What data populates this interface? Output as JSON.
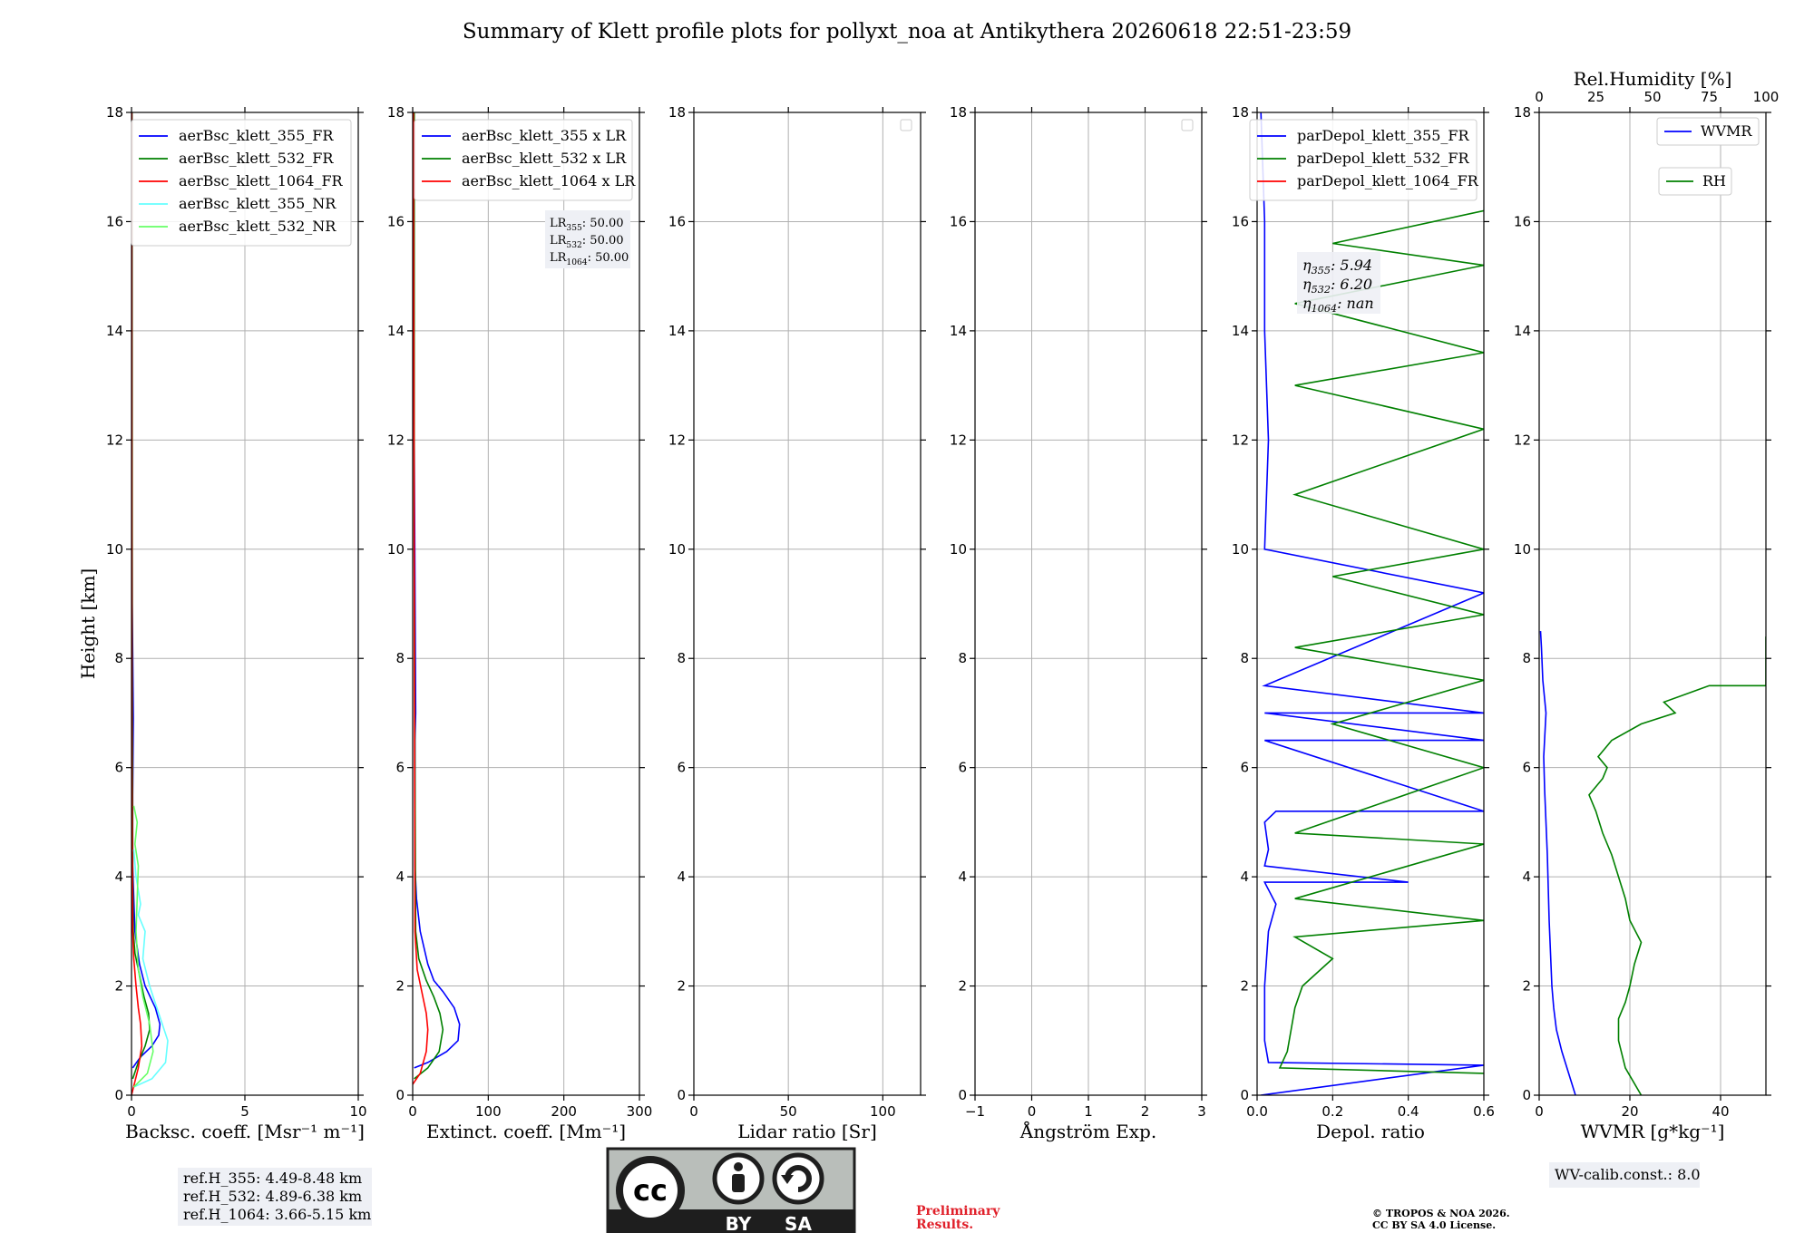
{
  "title": "Summary of Klett profile plots for pollyxt_noa at Antikythera 20260618 22:51-23:59",
  "ylabel": "Height [km]",
  "colors": {
    "blue": "#0000ff",
    "green": "#008000",
    "red": "#ff0000",
    "cyan": "#66ffff",
    "lightgreen": "#66ff66",
    "grid": "#b0b0b0"
  },
  "chart_data": [
    {
      "type": "line",
      "xlabel": "Backsc. coeff. [Msr⁻¹ m⁻¹]",
      "ylabel": "Height [km]",
      "xlim": [
        0,
        10
      ],
      "ylim": [
        0,
        18
      ],
      "xticks": [
        "0",
        "5",
        "10"
      ],
      "yticks": [
        "0",
        "2",
        "4",
        "6",
        "8",
        "10",
        "12",
        "14",
        "16",
        "18"
      ],
      "grid": true,
      "legend_placement": "top-right",
      "series": [
        {
          "name": "aerBsc_klett_355_FR",
          "color": "#0000ff",
          "x": [
            0.05,
            0.4,
            0.9,
            1.2,
            1.25,
            1.05,
            0.6,
            0.35,
            0.15,
            0.1,
            0.05,
            0.05,
            0.08,
            0.03,
            0.02,
            0.01
          ],
          "y": [
            0.5,
            0.7,
            0.9,
            1.1,
            1.3,
            1.6,
            2.0,
            2.4,
            3.0,
            3.6,
            4.2,
            5.5,
            6.9,
            9.0,
            13.0,
            18.0
          ]
        },
        {
          "name": "aerBsc_klett_532_FR",
          "color": "#008000",
          "x": [
            0.05,
            0.3,
            0.6,
            0.8,
            0.75,
            0.55,
            0.35,
            0.15,
            0.08,
            0.05,
            0.03,
            0.02
          ],
          "y": [
            0.3,
            0.6,
            0.9,
            1.2,
            1.5,
            1.8,
            2.2,
            2.6,
            3.0,
            4.0,
            8.0,
            18.0
          ]
        },
        {
          "name": "aerBsc_klett_1064_FR",
          "color": "#ff0000",
          "x": [
            0.0,
            0.3,
            0.45,
            0.4,
            0.3,
            0.2,
            0.1,
            0.05,
            0.02,
            0.01
          ],
          "y": [
            0.0,
            0.5,
            0.9,
            1.3,
            1.6,
            2.0,
            2.5,
            3.0,
            6.0,
            18.0
          ]
        },
        {
          "name": "aerBsc_klett_355_NR",
          "color": "#66ffff",
          "x": [
            0.1,
            0.9,
            1.5,
            1.6,
            1.2,
            0.8,
            0.5,
            0.6,
            0.3,
            0.4,
            0.2,
            0.1
          ],
          "y": [
            0.15,
            0.3,
            0.6,
            1.0,
            1.5,
            2.0,
            2.5,
            3.0,
            3.3,
            3.5,
            4.0,
            4.5
          ]
        },
        {
          "name": "aerBsc_klett_532_NR",
          "color": "#66ff66",
          "x": [
            0.1,
            0.7,
            0.95,
            0.8,
            0.5,
            0.3,
            0.2,
            0.3,
            0.15,
            0.25,
            0.1
          ],
          "y": [
            0.15,
            0.4,
            0.8,
            1.3,
            1.8,
            2.3,
            3.0,
            4.2,
            4.6,
            5.0,
            5.3
          ]
        }
      ],
      "annotation": [
        "ref.H_355: 4.49-8.48 km",
        "ref.H_532: 4.89-6.38 km",
        "ref.H_1064: 3.66-5.15 km"
      ]
    },
    {
      "type": "line",
      "xlabel": "Extinct. coeff. [Mm⁻¹]",
      "xlim": [
        0,
        300
      ],
      "ylim": [
        0,
        18
      ],
      "xticks": [
        "0",
        "100",
        "200",
        "300"
      ],
      "yticks": [
        "0",
        "2",
        "4",
        "6",
        "8",
        "10",
        "12",
        "14",
        "16",
        "18"
      ],
      "grid": true,
      "legend_placement": "top-right",
      "series": [
        {
          "name": "aerBsc_klett_355 x LR",
          "color": "#0000ff",
          "x": [
            2,
            20,
            45,
            60,
            62,
            55,
            40,
            28,
            20,
            10,
            5,
            3,
            3,
            4,
            2,
            1
          ],
          "y": [
            0.5,
            0.6,
            0.8,
            1.0,
            1.3,
            1.6,
            1.9,
            2.1,
            2.4,
            3.0,
            3.6,
            4.2,
            6.5,
            7.0,
            12.0,
            18.0
          ]
        },
        {
          "name": "aerBsc_klett_532 x LR",
          "color": "#008000",
          "x": [
            2,
            20,
            35,
            40,
            36,
            28,
            18,
            8,
            4,
            3,
            2,
            2
          ],
          "y": [
            0.3,
            0.5,
            0.8,
            1.2,
            1.5,
            1.8,
            2.1,
            2.5,
            3.0,
            6.0,
            10.0,
            18.0
          ]
        },
        {
          "name": "aerBsc_klett_1064 x LR",
          "color": "#ff0000",
          "x": [
            0,
            10,
            18,
            20,
            18,
            12,
            6,
            3,
            1
          ],
          "y": [
            0.2,
            0.4,
            0.8,
            1.2,
            1.5,
            1.9,
            2.3,
            3.0,
            18.0
          ]
        }
      ],
      "annotation": [
        "LR355: 50.00",
        "LR532: 50.00",
        "LR1064: 50.00"
      ]
    },
    {
      "type": "line",
      "xlabel": "Lidar ratio [Sr]",
      "xlim": [
        0,
        120
      ],
      "ylim": [
        0,
        18
      ],
      "xticks": [
        "0",
        "50",
        "100"
      ],
      "yticks": [
        "0",
        "2",
        "4",
        "6",
        "8",
        "10",
        "12",
        "14",
        "16",
        "18"
      ],
      "grid": true,
      "series": []
    },
    {
      "type": "line",
      "xlabel": "Ångström Exp.",
      "xlim": [
        -1,
        3
      ],
      "ylim": [
        0,
        18
      ],
      "xticks": [
        "−1",
        "0",
        "1",
        "2",
        "3"
      ],
      "yticks": [
        "0",
        "2",
        "4",
        "6",
        "8",
        "10",
        "12",
        "14",
        "16",
        "18"
      ],
      "grid": true,
      "series": []
    },
    {
      "type": "line",
      "xlabel": "Depol. ratio",
      "xlim": [
        0,
        0.6
      ],
      "ylim": [
        0,
        18
      ],
      "xticks": [
        "0.0",
        "0.2",
        "0.4",
        "0.6"
      ],
      "yticks": [
        "0",
        "2",
        "4",
        "6",
        "8",
        "10",
        "12",
        "14",
        "16",
        "18"
      ],
      "grid": true,
      "legend_placement": "top-right",
      "series": [
        {
          "name": "parDepol_klett_355_FR",
          "color": "#0000ff",
          "x": [
            0.01,
            0.6,
            0.03,
            0.02,
            0.02,
            0.03,
            0.05,
            0.02,
            0.4,
            0.02,
            0.03,
            0.02,
            0.05,
            0.6,
            0.02,
            0.6,
            0.02,
            0.6,
            0.02,
            0.6,
            0.02,
            0.03,
            0.02,
            0.02,
            0.01
          ],
          "y": [
            0.0,
            0.55,
            0.6,
            1.0,
            2.0,
            3.0,
            3.5,
            3.9,
            3.9,
            4.2,
            4.5,
            5.0,
            5.2,
            5.2,
            6.5,
            6.5,
            7.0,
            7.0,
            7.5,
            9.2,
            10.0,
            12.0,
            14.0,
            16.0,
            18.0
          ]
        },
        {
          "name": "parDepol_klett_532_FR",
          "color": "#008000",
          "x": [
            0.6,
            0.06,
            0.08,
            0.09,
            0.1,
            0.12,
            0.2,
            0.1,
            0.6,
            0.1,
            0.6,
            0.1,
            0.6,
            0.2,
            0.6,
            0.1,
            0.6,
            0.2,
            0.6,
            0.1,
            0.6,
            0.1,
            0.6,
            0.1,
            0.6,
            0.2,
            0.6
          ],
          "y": [
            0.4,
            0.5,
            0.8,
            1.2,
            1.6,
            2.0,
            2.5,
            2.9,
            3.2,
            3.6,
            4.6,
            4.8,
            6.0,
            6.8,
            7.6,
            8.2,
            8.8,
            9.5,
            10.0,
            11.0,
            12.2,
            13.0,
            13.6,
            14.5,
            15.2,
            15.6,
            16.2
          ]
        },
        {
          "name": "parDepol_klett_1064_FR",
          "color": "#ff0000",
          "x": [],
          "y": []
        }
      ],
      "annotation": [
        "η355: 5.94",
        "η532: 6.20",
        "η1064: nan"
      ]
    },
    {
      "type": "line",
      "xlabel": "WVMR [g*kg⁻¹]",
      "x2label": "Rel.Humidity [%]",
      "xlim": [
        0,
        50
      ],
      "x2lim": [
        0,
        100
      ],
      "ylim": [
        0,
        18
      ],
      "xticks": [
        "0",
        "20",
        "40"
      ],
      "x2ticks": [
        "0",
        "25",
        "50",
        "75",
        "100"
      ],
      "yticks": [
        "0",
        "2",
        "4",
        "6",
        "8",
        "10",
        "12",
        "14",
        "16",
        "18"
      ],
      "grid": true,
      "legend_placement": "top-right",
      "series": [
        {
          "name": "WVMR",
          "color": "#0000ff",
          "axis": "bottom",
          "x": [
            8.0,
            6.5,
            5.0,
            3.8,
            3.2,
            2.8,
            2.5,
            2.2,
            2.0,
            1.8,
            1.5,
            1.2,
            1.0,
            1.5,
            0.8,
            0.5,
            0.3
          ],
          "y": [
            0.0,
            0.4,
            0.8,
            1.2,
            1.6,
            2.0,
            2.6,
            3.2,
            3.8,
            4.4,
            5.0,
            5.6,
            6.2,
            7.0,
            7.6,
            8.2,
            8.5
          ]
        },
        {
          "name": "RH",
          "color": "#008000",
          "axis": "top",
          "x": [
            45,
            38,
            35,
            35,
            38,
            40,
            42,
            45,
            40,
            38,
            35,
            32,
            28,
            25,
            22,
            28,
            30,
            26,
            32,
            45,
            60,
            55,
            75,
            100,
            100,
            100
          ],
          "y": [
            0.0,
            0.5,
            1.0,
            1.4,
            1.7,
            2.0,
            2.4,
            2.8,
            3.2,
            3.6,
            4.0,
            4.4,
            4.8,
            5.2,
            5.5,
            5.8,
            6.0,
            6.2,
            6.5,
            6.8,
            7.0,
            7.2,
            7.5,
            7.5,
            8.4,
            8.4
          ]
        }
      ],
      "annotation": [
        "WV-calib.const.: 8.0"
      ]
    }
  ],
  "footer": {
    "cc_letters": "cc",
    "by_label": "BY",
    "sa_label": "SA",
    "preliminary_line1": "Preliminary",
    "preliminary_line2": "Results.",
    "copyright_line1": "© TROPOS & NOA 2026.",
    "copyright_line2": "CC BY SA 4.0 License."
  }
}
